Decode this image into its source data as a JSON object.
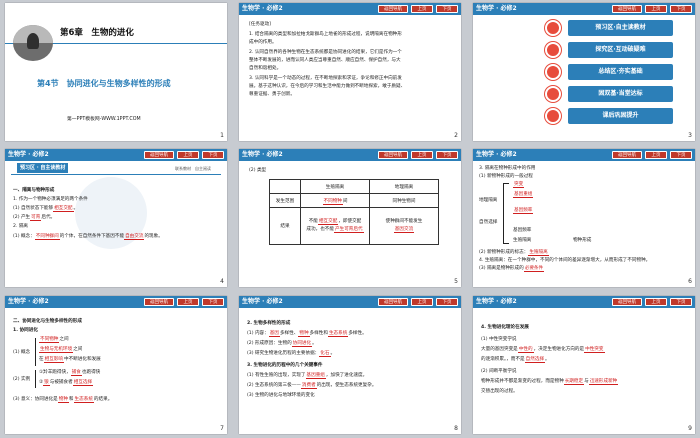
{
  "header": {
    "title": "生物学 · 必修2",
    "nav_labels": [
      "返回导航",
      "上页",
      "下页"
    ]
  },
  "slides": {
    "s1": {
      "page": "1",
      "chapter": "第6章　生物的进化",
      "section": "第4节　协同进化与生物多样性的形成",
      "footer": "第一PPT模板网-WWW.1PPT.COM"
    },
    "s2": {
      "page": "2",
      "lines": [
        "[任务驱动]",
        "1. 结合隔离的类型和加拉帕戈斯群岛上地雀的形成过程，说明隔离在物种形",
        "成中的作用。",
        "2. 认同自然界的各种生物在生态系统都是协同进化的结果，它们是作为一个",
        "整体不断发展的，进而认同人类应当尊重自然、顺应自然、保护自然，与大",
        "自然和谐相处。",
        "3. 认同科学是一个动态的过程，在不断地探索和求证，争论和修正中向前发",
        "展。基于这种认识，在今后的学习和生活中能力做到不断地探索，敢于质疑、",
        "尊重证据、勇于创新。"
      ]
    },
    "s3": {
      "page": "3",
      "menu": [
        "预习区·自主读教材",
        "探究区·互动破疑难",
        "总结区·夯实基础",
        "固双基·当堂达标",
        "课后巩固提升"
      ]
    },
    "s4": {
      "page": "4",
      "tag": "预习区 · 自主读教材",
      "right": "联系教材　自主阅读",
      "lines": [
        "一、隔离与物种形成",
        "1. 作为一个物种必须满足的两个条件",
        "(1) 自然状态下能够",
        "(2) 产生",
        "2. 隔离",
        "(1) 概念：",
        "不同种群间",
        "的个体，在自然条件下基因不能",
        "的现象。"
      ],
      "blanks": [
        "相互交配",
        "可育",
        "自由交流"
      ]
    },
    "s5": {
      "page": "5",
      "title": "(2) 类型",
      "col1": "生殖隔离",
      "col2": "地理隔离",
      "row1_label": "发生范围",
      "row1_a": "不同物种",
      "row1_a_tail": "间",
      "row1_b": "同种生物间",
      "row2_label": "结果",
      "row2_a": [
        "不能",
        "相互交配",
        "，即使交配",
        "成功，也不能",
        "产生可育后代"
      ],
      "row2_b": [
        "使种群间不能发生",
        "基因交流"
      ]
    },
    "s6": {
      "page": "6",
      "lines": [
        "3. 隔离在物种形成中的作用",
        "(1) 新物种形成的一般过程",
        "(2) 新物种形成的标志：",
        "(3) 隔离是物种形成的",
        "4. 生殖隔离：在一个种群中，不同的个体间的差异逐渐增大，从而形成了不同物种。"
      ],
      "flow": [
        "地理隔离",
        "自然选择",
        "基因频率",
        "生殖隔离",
        "物种形成"
      ],
      "blanks": [
        "突变",
        "基因重组",
        "基因频率",
        "生殖隔离",
        "必要条件"
      ]
    },
    "s7": {
      "page": "7",
      "lines": [
        "二、协同进化与生物多样性的形成",
        "1. 协同进化",
        "(1) 概念",
        "(2) 实例",
        "(3) 意义：协同进化是",
        "的结果。"
      ],
      "blanks": [
        "不同物种",
        "生物与无机环境",
        "相互影响",
        "捕食",
        "狼",
        "相互选择",
        "物种",
        "生态系统"
      ]
    },
    "s8": {
      "page": "8",
      "lines": [
        "2. 生物多样性的形成",
        "(1) 内容：",
        "(2) 形成原因：生物的",
        "(3) 研究生物进化历程的主要依据：",
        "3. 生物进化的历程中的几个关键事件",
        "(1) 有性生殖的出现，实现了",
        "(2) 生态系统的第三极——",
        "(3) 生物的进化与地球环境的变化"
      ],
      "blanks": [
        "基因",
        "物种",
        "生态系统",
        "协同进化",
        "化石",
        "基因重组",
        "消费者"
      ]
    },
    "s9": {
      "page": "9",
      "lines": [
        "4. 生物进化理论在发展",
        "(1) 中性突变学说",
        "大量的基因突变是",
        "，决定生物进化方向的是",
        "的逐渐积累。",
        "(2) 间断平衡学说",
        "物种形成并不都是渐变的过程，而是物种",
        "与",
        "交替出现的过程。"
      ],
      "blanks": [
        "中性的",
        "中性突变",
        "自然选择",
        "长期稳定",
        "迅速形成新种"
      ]
    }
  }
}
